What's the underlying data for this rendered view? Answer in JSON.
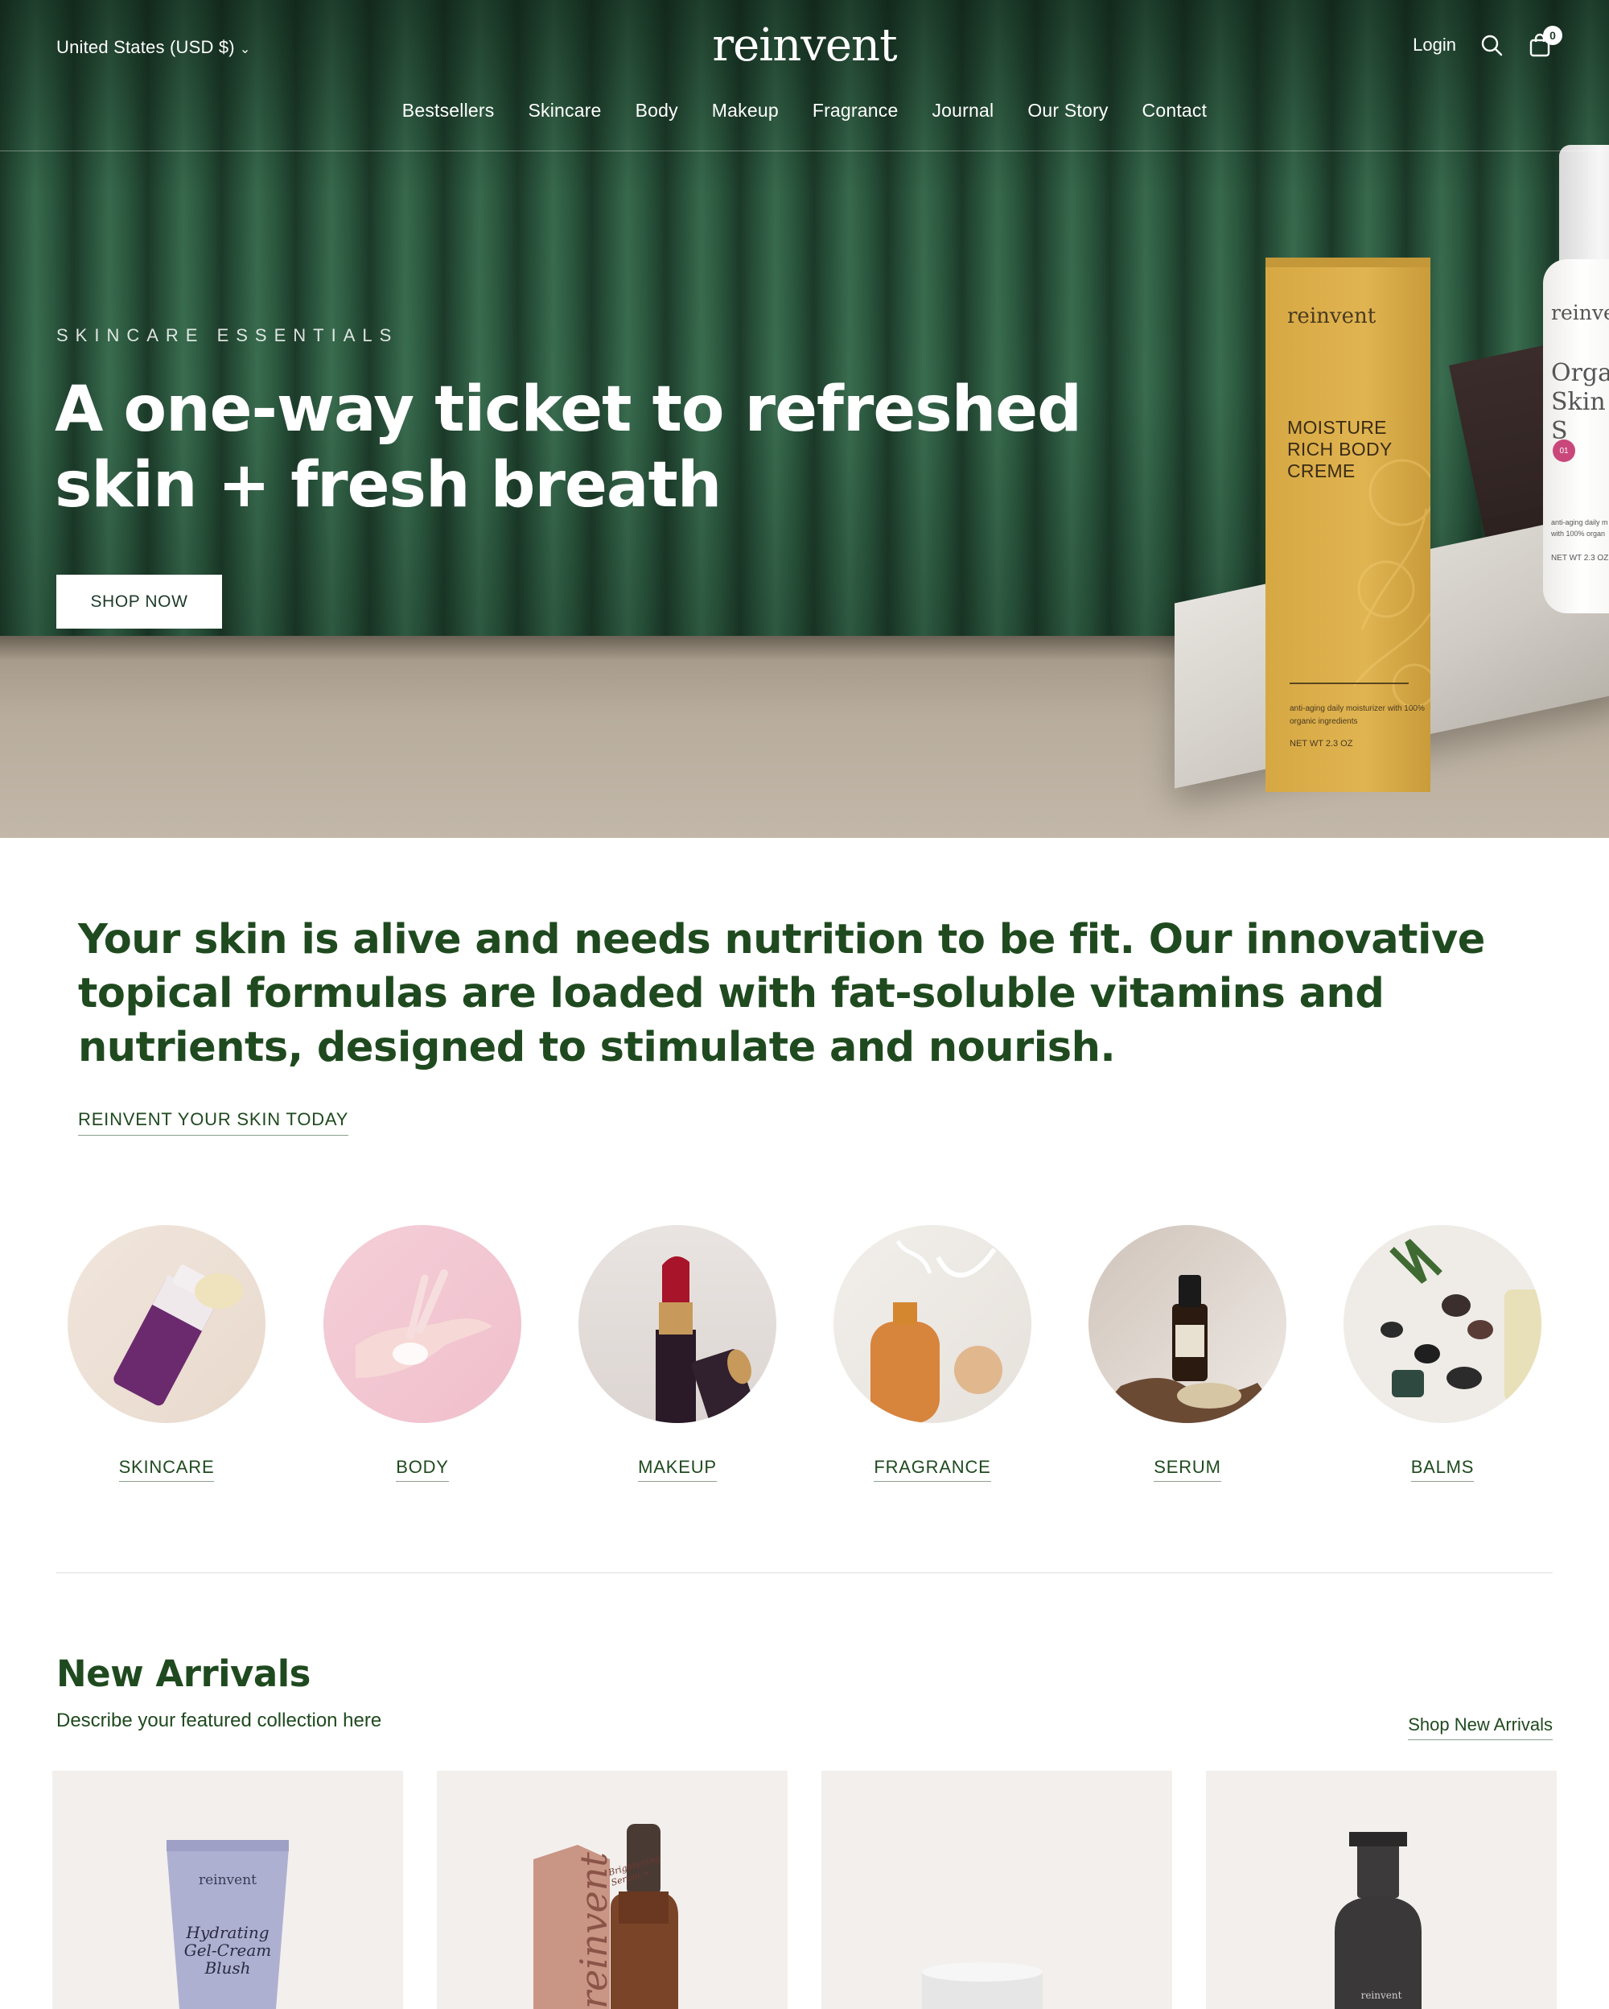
{
  "header": {
    "currency": "United States (USD $)",
    "logo": "reinvent",
    "login": "Login",
    "cart_count": "0",
    "nav": [
      "Bestsellers",
      "Skincare",
      "Body",
      "Makeup",
      "Fragrance",
      "Journal",
      "Our Story",
      "Contact"
    ]
  },
  "hero": {
    "eyebrow": "SKINCARE ESSENTIALS",
    "title_line1": "A one-way ticket to refreshed",
    "title_line2": "skin + fresh breath",
    "cta": "SHOP NOW",
    "box": {
      "brand": "reinvent",
      "name": "MOISTURE RICH BODY CREME",
      "small": "anti-aging daily moisturizer with 100% organic ingredients",
      "weight": "NET WT 2.3 OZ"
    },
    "bottle": {
      "brand": "reinver",
      "name": "Orga Skin S",
      "badge": "01",
      "small": "anti-aging daily m with 100% organ",
      "weight": "NET WT 2.3 OZ"
    }
  },
  "intro": {
    "text": "Your skin is alive and needs nutrition to be fit. Our innovative topical formulas are loaded with fat-soluble vitamins and nutrients, designed to stimulate and nourish.",
    "link": "REINVENT YOUR SKIN TODAY"
  },
  "categories": [
    {
      "label": "SKINCARE"
    },
    {
      "label": "BODY"
    },
    {
      "label": "MAKEUP"
    },
    {
      "label": "FRAGRANCE"
    },
    {
      "label": "SERUM"
    },
    {
      "label": "BALMS"
    }
  ],
  "new_arrivals": {
    "title": "New Arrivals",
    "subtitle": "Describe your featured collection here",
    "link": "Shop New Arrivals",
    "products": [
      {
        "brand": "reinvent",
        "name": "Hydrating Gel-Cream Blush"
      },
      {
        "brand": "reinvent",
        "name": "Brightening Serum +"
      },
      {
        "brand": "",
        "name": ""
      },
      {
        "brand": "reinvent",
        "name": ""
      }
    ]
  },
  "colors": {
    "brand_green": "#1f4a1f",
    "hero_green": "#2a553d",
    "box_gold": "#d6a843",
    "card_bg": "#f3efec"
  }
}
